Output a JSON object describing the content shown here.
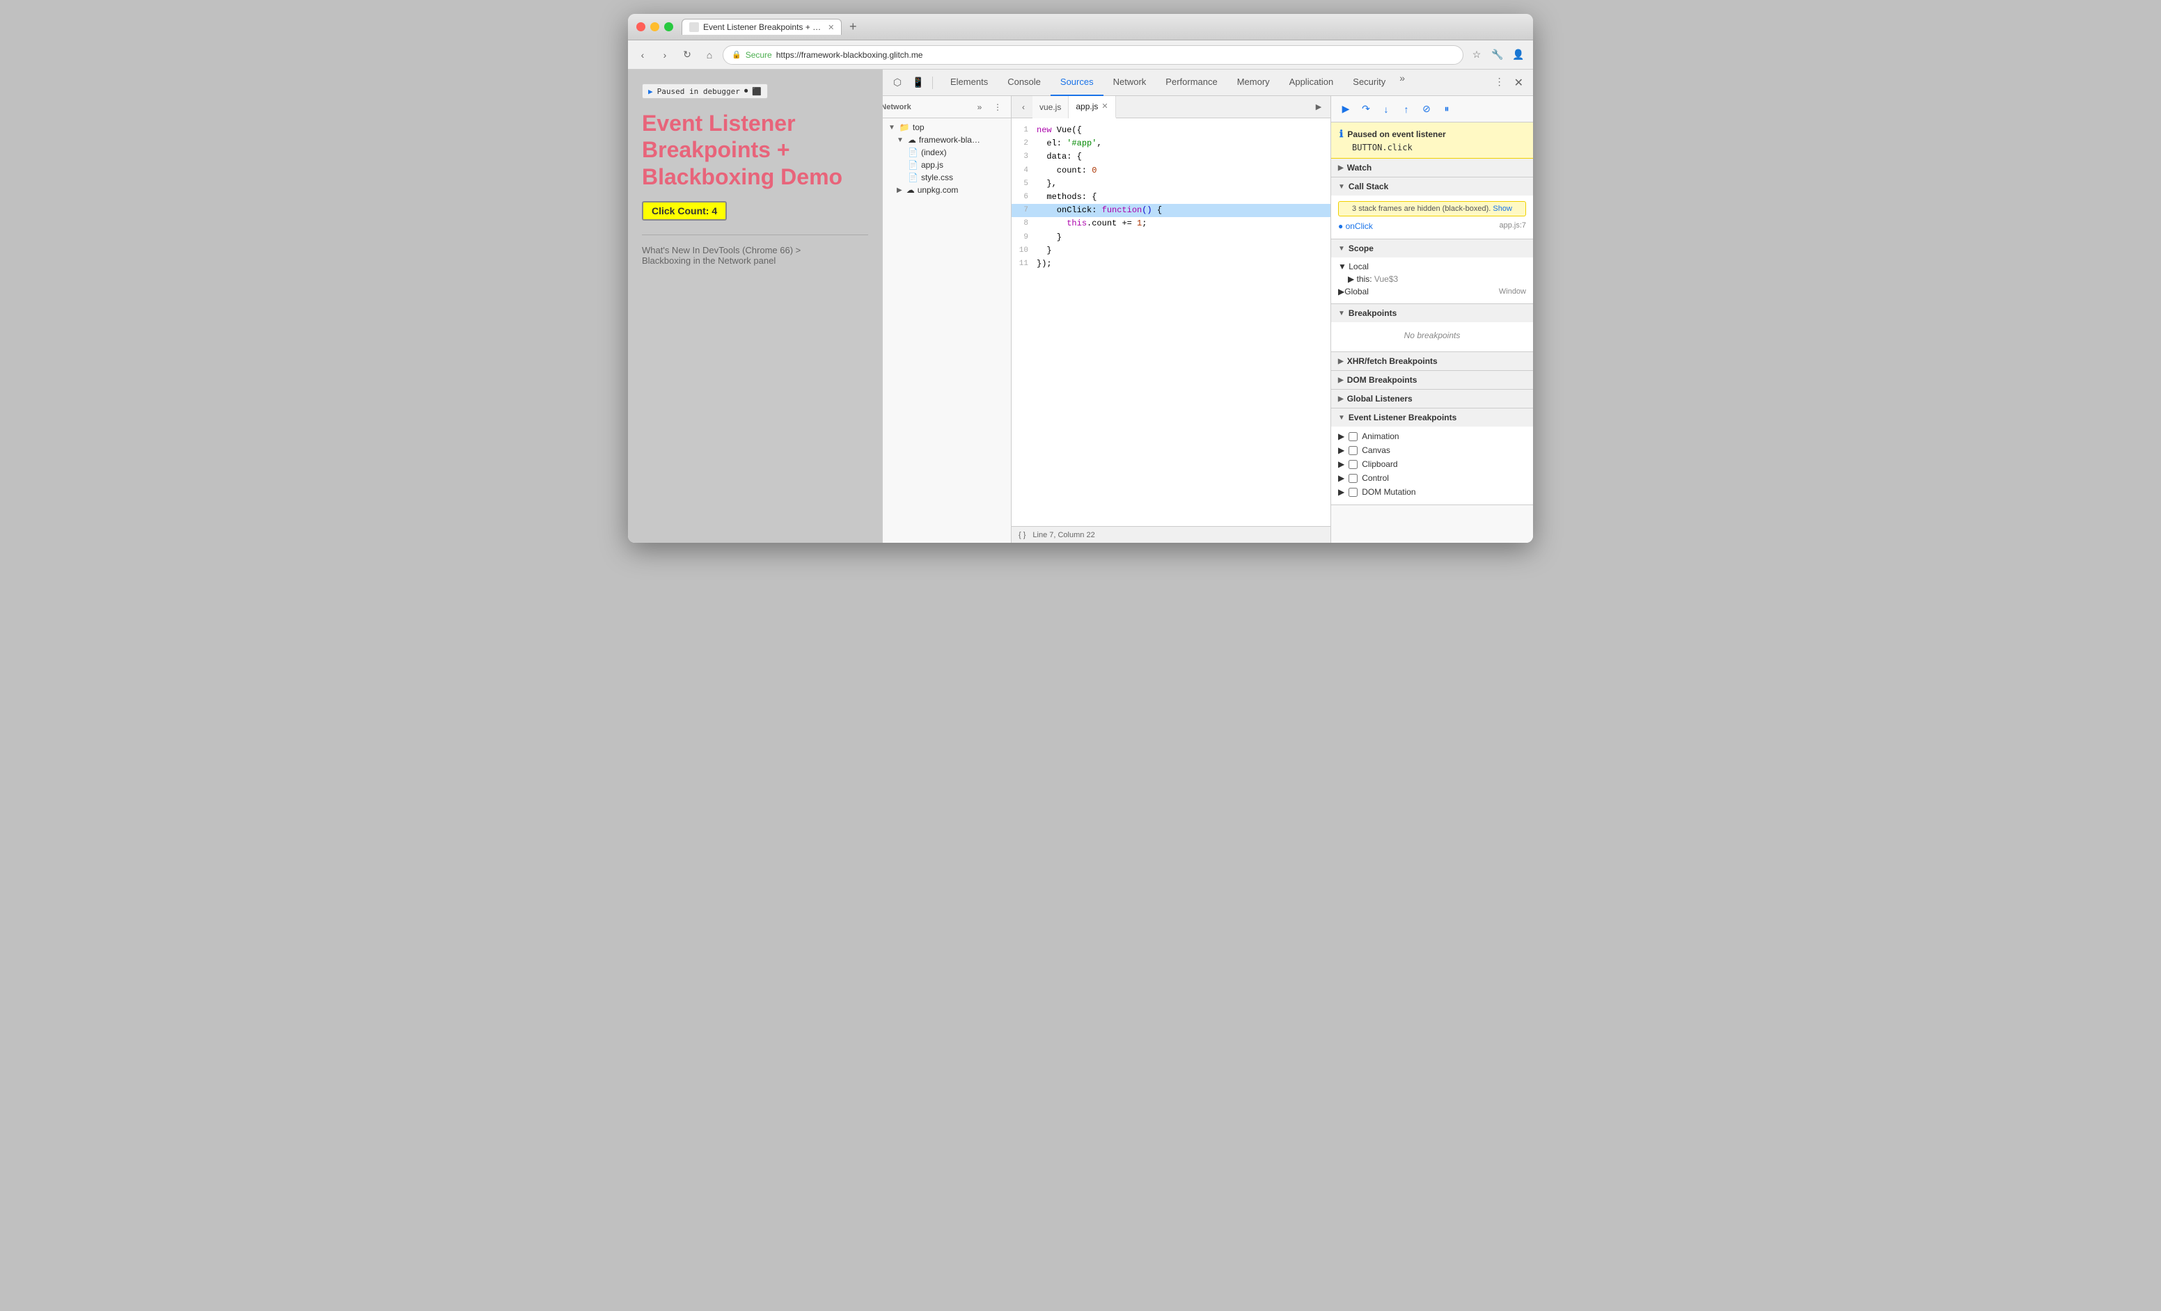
{
  "browser": {
    "tab_title": "Event Listener Breakpoints + …",
    "address": "https://framework-blackboxing.glitch.me",
    "secure_label": "Secure"
  },
  "page": {
    "paused_banner": "Paused in debugger",
    "title": "Event Listener\nBreakpoints +\nBlackboxing Demo",
    "click_count": "Click Count: 4",
    "link1": "What's New In DevTools (Chrome 66) >",
    "link2": "Blackboxing in the Network panel"
  },
  "devtools": {
    "tabs": [
      "Elements",
      "Console",
      "Sources",
      "Network",
      "Performance",
      "Memory",
      "Application",
      "Security"
    ],
    "active_tab": "Sources"
  },
  "file_tree": {
    "toolbar_items": [
      "back",
      "forward",
      "more"
    ],
    "items": [
      {
        "label": "top",
        "level": 0,
        "type": "folder",
        "open": true
      },
      {
        "label": "framework-bla…",
        "level": 1,
        "type": "folder-cloud",
        "open": true
      },
      {
        "label": "(index)",
        "level": 2,
        "type": "file"
      },
      {
        "label": "app.js",
        "level": 2,
        "type": "file-js"
      },
      {
        "label": "style.css",
        "level": 2,
        "type": "file-css"
      },
      {
        "label": "unpkg.com",
        "level": 1,
        "type": "folder-cloud"
      }
    ]
  },
  "editor": {
    "tabs": [
      "vue.js",
      "app.js"
    ],
    "active_tab": "app.js",
    "lines": [
      {
        "num": 1,
        "content": "new Vue({",
        "highlight": false
      },
      {
        "num": 2,
        "content": "  el: '#app',",
        "highlight": false
      },
      {
        "num": 3,
        "content": "  data: {",
        "highlight": false
      },
      {
        "num": 4,
        "content": "    count: 0",
        "highlight": false
      },
      {
        "num": 5,
        "content": "  },",
        "highlight": false
      },
      {
        "num": 6,
        "content": "  methods: {",
        "highlight": false
      },
      {
        "num": 7,
        "content": "    onClick: function() {",
        "highlight": true
      },
      {
        "num": 8,
        "content": "      this.count += 1;",
        "highlight": false
      },
      {
        "num": 9,
        "content": "    }",
        "highlight": false
      },
      {
        "num": 10,
        "content": "  }",
        "highlight": false
      },
      {
        "num": 11,
        "content": "});",
        "highlight": false
      }
    ],
    "status": "Line 7, Column 22"
  },
  "debugger": {
    "toolbar_buttons": [
      "resume",
      "step-over",
      "step-into",
      "step-out",
      "deactivate",
      "pause"
    ],
    "paused_title": "Paused on event listener",
    "paused_event": "BUTTON.click",
    "sections": {
      "watch": {
        "label": "Watch",
        "open": false
      },
      "call_stack": {
        "label": "Call Stack",
        "open": true,
        "blackbox_note": "3 stack frames are hidden (black-boxed).",
        "show_link": "Show",
        "items": [
          {
            "name": "onClick",
            "loc": "app.js:7"
          }
        ]
      },
      "scope": {
        "label": "Scope",
        "open": true,
        "local_label": "Local",
        "local_items": [
          {
            "name": "▶ this",
            "value": "Vue$3"
          }
        ],
        "global_label": "Global",
        "global_value": "Window"
      },
      "breakpoints": {
        "label": "Breakpoints",
        "open": true,
        "items": [],
        "empty_text": "No breakpoints"
      },
      "xhr_breakpoints": {
        "label": "XHR/fetch Breakpoints",
        "open": false
      },
      "dom_breakpoints": {
        "label": "DOM Breakpoints",
        "open": false
      },
      "global_listeners": {
        "label": "Global Listeners",
        "open": false
      },
      "event_listener_breakpoints": {
        "label": "Event Listener Breakpoints",
        "open": true,
        "items": [
          {
            "label": "Animation",
            "checked": false
          },
          {
            "label": "Canvas",
            "checked": false
          },
          {
            "label": "Clipboard",
            "checked": false
          },
          {
            "label": "Control",
            "checked": false
          },
          {
            "label": "DOM Mutation",
            "checked": false
          }
        ]
      }
    }
  }
}
